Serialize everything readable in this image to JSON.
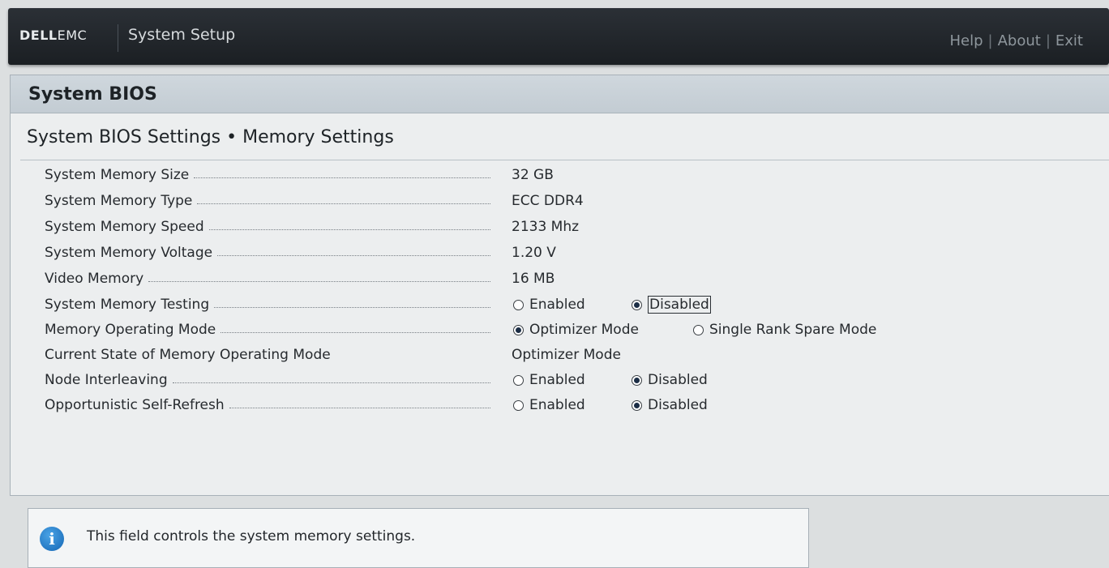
{
  "header": {
    "logo_dell": "DELL",
    "logo_emc": "EMC",
    "app_title": "System Setup",
    "links": [
      "Help",
      "About",
      "Exit"
    ],
    "link_separator": "|"
  },
  "panel": {
    "title": "System BIOS",
    "section_title": "System BIOS Settings • Memory Settings"
  },
  "settings": {
    "memory_size": {
      "label": "System Memory Size",
      "value": "32 GB"
    },
    "memory_type": {
      "label": "System Memory Type",
      "value": "ECC DDR4"
    },
    "memory_speed": {
      "label": "System Memory Speed",
      "value": "2133 Mhz"
    },
    "memory_voltage": {
      "label": "System Memory Voltage",
      "value": "1.20 V"
    },
    "video_memory": {
      "label": "Video Memory",
      "value": "16 MB"
    },
    "memory_testing": {
      "label": "System Memory Testing",
      "opt1": "Enabled",
      "opt2": "Disabled",
      "selected": "Disabled"
    },
    "operating_mode": {
      "label": "Memory Operating Mode",
      "opt1": "Optimizer Mode",
      "opt2": "Single Rank Spare Mode",
      "selected": "Optimizer Mode"
    },
    "current_state": {
      "label": "Current State of Memory Operating Mode",
      "value": "Optimizer Mode"
    },
    "node_interleaving": {
      "label": "Node Interleaving",
      "opt1": "Enabled",
      "opt2": "Disabled",
      "selected": "Disabled"
    },
    "self_refresh": {
      "label": "Opportunistic Self-Refresh",
      "opt1": "Enabled",
      "opt2": "Disabled",
      "selected": "Disabled"
    }
  },
  "info": {
    "icon": "info-icon",
    "text": "This field controls the system memory settings."
  }
}
